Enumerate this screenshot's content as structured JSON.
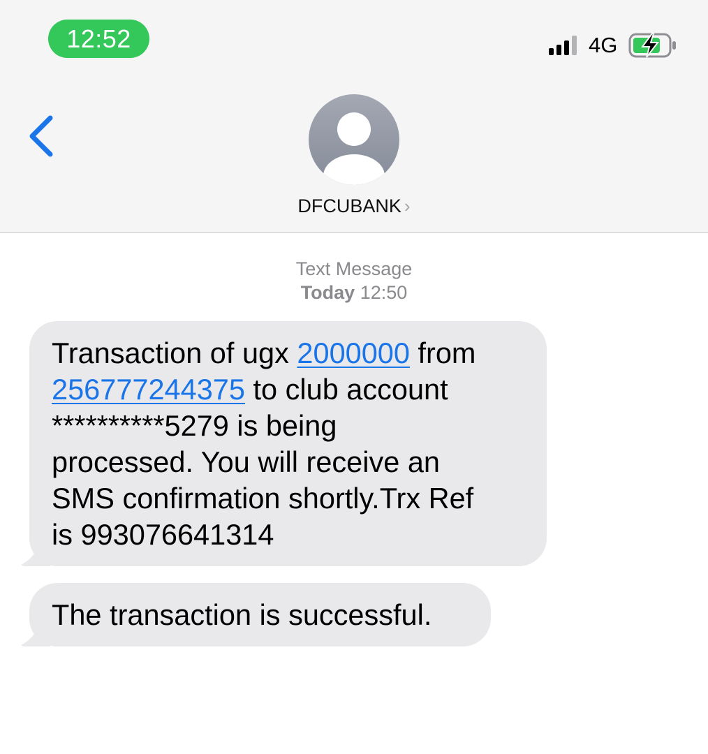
{
  "status_bar": {
    "time": "12:52",
    "network": "4G",
    "time_pill_color": "#34c759",
    "icons": [
      "cellular-signal-icon",
      "battery-charging-icon"
    ]
  },
  "nav": {
    "back_icon": "chevron-left-icon",
    "contact_name": "DFCUBANK",
    "contact_chevron": "›",
    "avatar_icon": "person-avatar-icon"
  },
  "thread": {
    "message_type": "Text Message",
    "date_label": "Today",
    "time_label": "12:50"
  },
  "messages": [
    {
      "lines": [
        {
          "before": "Transaction of ugx ",
          "link": "2000000",
          "after": " from"
        },
        {
          "before": "",
          "link": "256777244375",
          "after": " to club account"
        },
        {
          "text": "**********5279 is being"
        },
        {
          "text": "processed. You will receive an"
        },
        {
          "text": "SMS confirmation shortly.Trx Ref"
        },
        {
          "text": "is 993076641314"
        }
      ]
    },
    {
      "text": "The transaction is successful."
    }
  ],
  "colors": {
    "link": "#1a75e8",
    "bubble": "#e9e9eb",
    "back_accent": "#1a75e8"
  }
}
